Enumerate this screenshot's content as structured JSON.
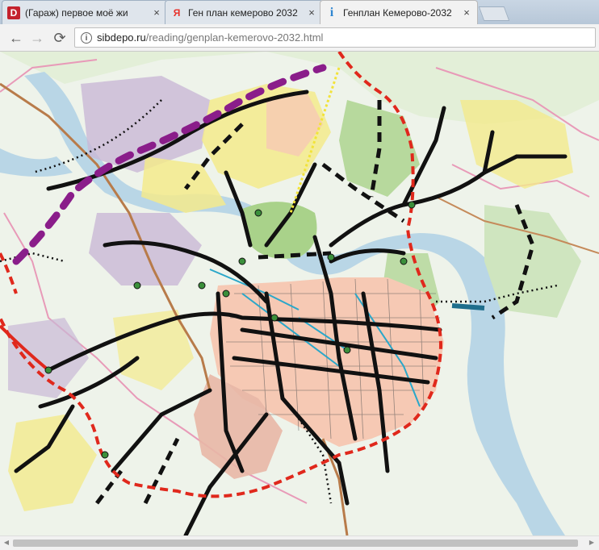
{
  "browser": {
    "tabs": [
      {
        "favicon": "D",
        "favicon_color": "#c4222d",
        "title": "(Гараж) первое моё жи",
        "close": "×"
      },
      {
        "favicon": "Я",
        "favicon_color": "#e8312a",
        "title": "Ген план кемерово 2032",
        "close": "×"
      },
      {
        "favicon": "i",
        "favicon_color": "#2f86d1",
        "title": "Генплан Кемерово-2032",
        "close": "×"
      }
    ],
    "nav": {
      "back": "←",
      "forward": "→",
      "reload": "⟳"
    },
    "address": {
      "host": "sibdepo.ru",
      "path": "/reading/genplan-kemerovo-2032.html",
      "info_icon": "i"
    }
  },
  "map": {
    "colors": {
      "background": "#eaf1e6",
      "river": "#b9d6e6",
      "residential": "#f6c9b4",
      "industrial": "#c9b8d6",
      "green": "#a9d28a",
      "yellow_zone": "#f3ea8c",
      "boundary": "#e89ab8",
      "ring_road": "#e0281c",
      "main_road": "#111111",
      "metro": "#8a1d8a",
      "rail": "#b87b4a"
    }
  },
  "scrollbar": {
    "left_arrow": "◀",
    "right_arrow": "▶"
  }
}
